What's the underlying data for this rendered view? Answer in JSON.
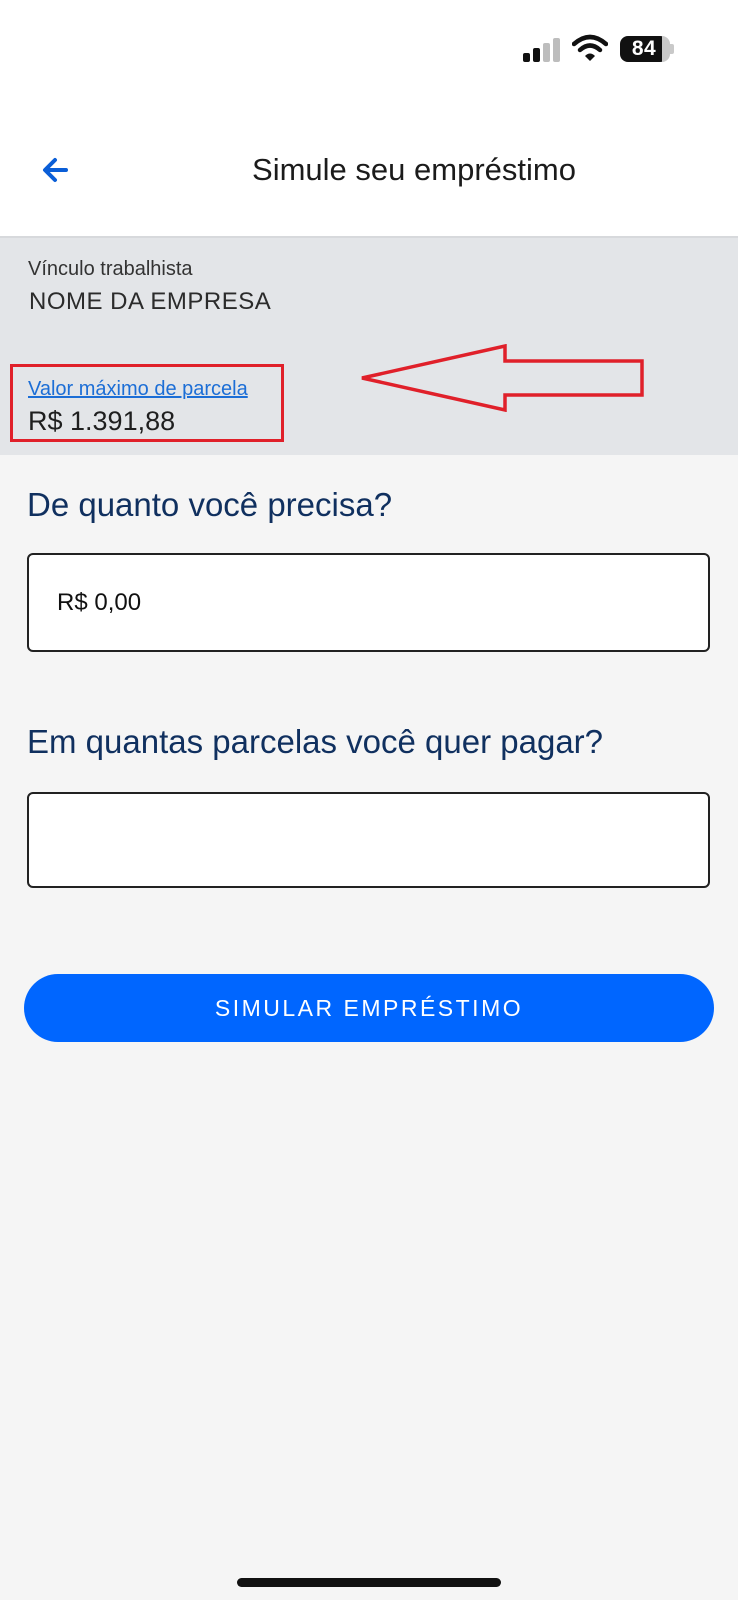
{
  "status_bar": {
    "battery_level": "84"
  },
  "header": {
    "title": "Simule seu empréstimo"
  },
  "employment": {
    "label": "Vínculo trabalhista",
    "company": "NOME DA EMPRESA"
  },
  "max_installment": {
    "label": "Valor máximo de parcela",
    "value": "R$ 1.391,88"
  },
  "form": {
    "amount_question": "De quanto você precisa?",
    "amount_value": "R$ 0,00",
    "installments_question": "Em quantas parcelas você quer pagar?",
    "installments_value": ""
  },
  "actions": {
    "simulate_label": "SIMULAR EMPRÉSTIMO"
  },
  "colors": {
    "primary": "#0066ff",
    "annotation": "#e0202a",
    "heading": "#10305f",
    "link": "#1c6ed6"
  },
  "icons": {
    "back": "arrow-left-icon",
    "signal": "cellular-signal-icon",
    "wifi": "wifi-icon",
    "battery": "battery-icon"
  }
}
